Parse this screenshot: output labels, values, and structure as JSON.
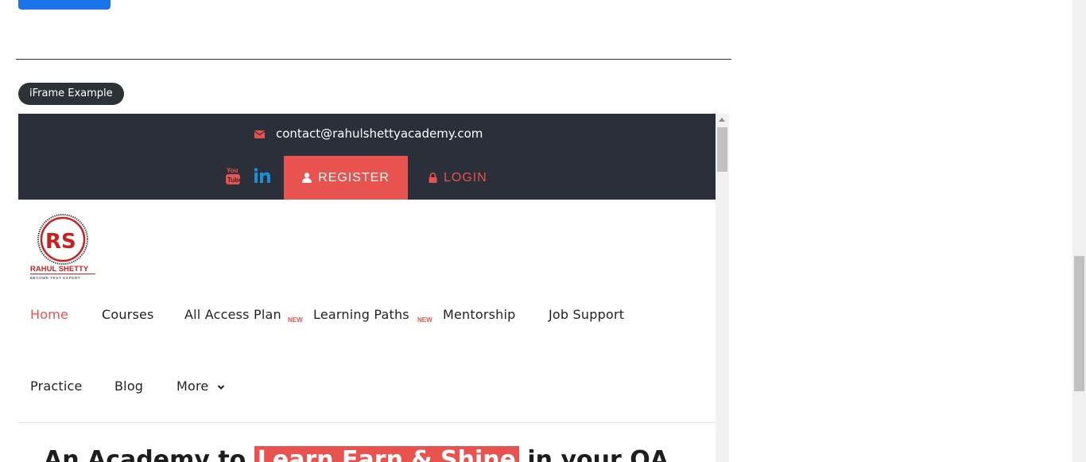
{
  "pill_label": "iFrame Example",
  "frame": {
    "email": "contact@rahulshettyacademy.com",
    "register_label": "REGISTER",
    "login_label": "LOGIN",
    "logo_text": "RAHUL SHETTY",
    "logo_sub": "BECOME TEST EXPERT",
    "nav": {
      "home": "Home",
      "courses": "Courses",
      "all_access": "All Access Plan",
      "learning_paths": "Learning Paths",
      "mentorship": "Mentorship",
      "job_support": "Job Support",
      "practice": "Practice",
      "blog": "Blog",
      "more": "More",
      "new_badge": "NEW"
    },
    "hero": {
      "prefix": "An Academy to ",
      "highlight": "Learn Earn & Shine",
      "suffix": " in your QA"
    }
  },
  "colors": {
    "accent": "#e8534f",
    "topbar": "#2a2f3a",
    "pill": "#2b3336",
    "primary_button": "#1a73e8"
  },
  "icons": [
    "envelope-icon",
    "youtube-icon",
    "linkedin-icon",
    "user-icon",
    "lock-icon",
    "chevron-down-icon"
  ]
}
